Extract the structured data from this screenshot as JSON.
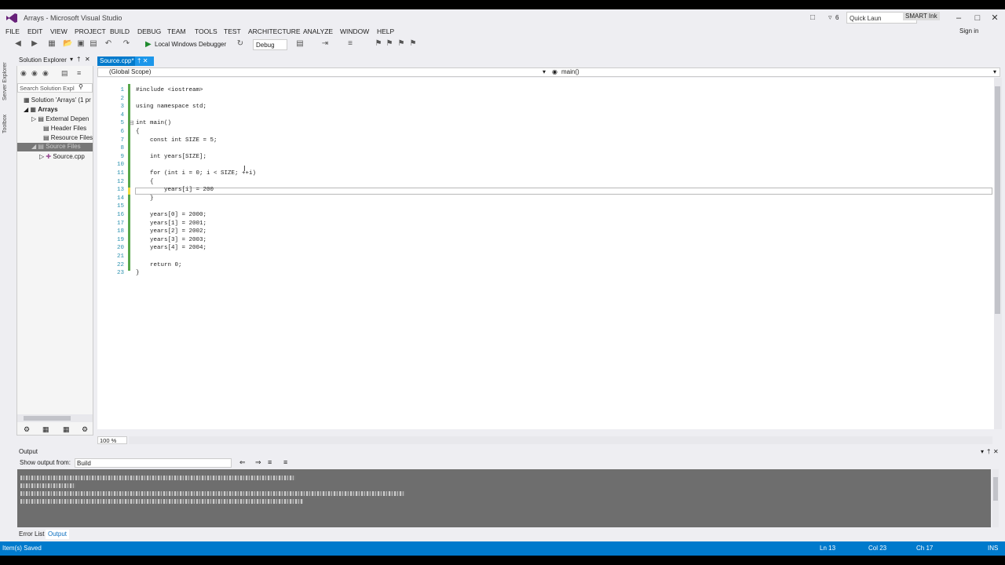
{
  "window": {
    "title": "Arrays - Microsoft Visual Studio",
    "notification_count": "6",
    "quick_launch": "Quick Laun",
    "smart_ink": "SMART Ink",
    "sign_in": "Sign in"
  },
  "menu": [
    "FILE",
    "EDIT",
    "VIEW",
    "PROJECT",
    "BUILD",
    "DEBUG",
    "TEAM",
    "TOOLS",
    "TEST",
    "ARCHITECTURE",
    "ANALYZE",
    "WINDOW",
    "HELP"
  ],
  "toolbar": {
    "debugger_label": "Local Windows Debugger",
    "configuration": "Debug"
  },
  "side_tabs": {
    "server_explorer": "Server Explorer",
    "toolbox": "Toolbox"
  },
  "solution_explorer": {
    "title": "Solution Explorer",
    "search_placeholder": "Search Solution Expl",
    "items": [
      {
        "label": "Solution 'Arrays' (1 pr",
        "indent": 0
      },
      {
        "label": "Arrays",
        "indent": 1
      },
      {
        "label": "External Depen",
        "indent": 2
      },
      {
        "label": "Header Files",
        "indent": 2
      },
      {
        "label": "Resource Files",
        "indent": 2
      },
      {
        "label": "Source Files",
        "indent": 2
      },
      {
        "label": "Source.cpp",
        "indent": 3
      }
    ]
  },
  "editor": {
    "tab_label": "Source.cpp*",
    "scope": "(Global Scope)",
    "member": "main()",
    "zoom": "100 %",
    "lines": [
      "#include <iostream>",
      "",
      "using namespace std;",
      "",
      "int main()",
      "{",
      "    const int SIZE = 5;",
      "",
      "    int years[SIZE];",
      "",
      "    for (int i = 0; i < SIZE; ++i)",
      "    {",
      "        years[i] = 200",
      "    }",
      "",
      "    years[0] = 2000;",
      "    years[1] = 2001;",
      "    years[2] = 2002;",
      "    years[3] = 2003;",
      "    years[4] = 2004;",
      "",
      "    return 0;",
      "}"
    ]
  },
  "output": {
    "title": "Output",
    "show_output_from_label": "Show output from:",
    "source": "Build"
  },
  "bottom_tabs": [
    "Error List",
    "Output"
  ],
  "status": {
    "message": "Item(s) Saved",
    "line": "Ln 13",
    "col": "Col 23",
    "ch": "Ch 17",
    "mode": "INS"
  }
}
